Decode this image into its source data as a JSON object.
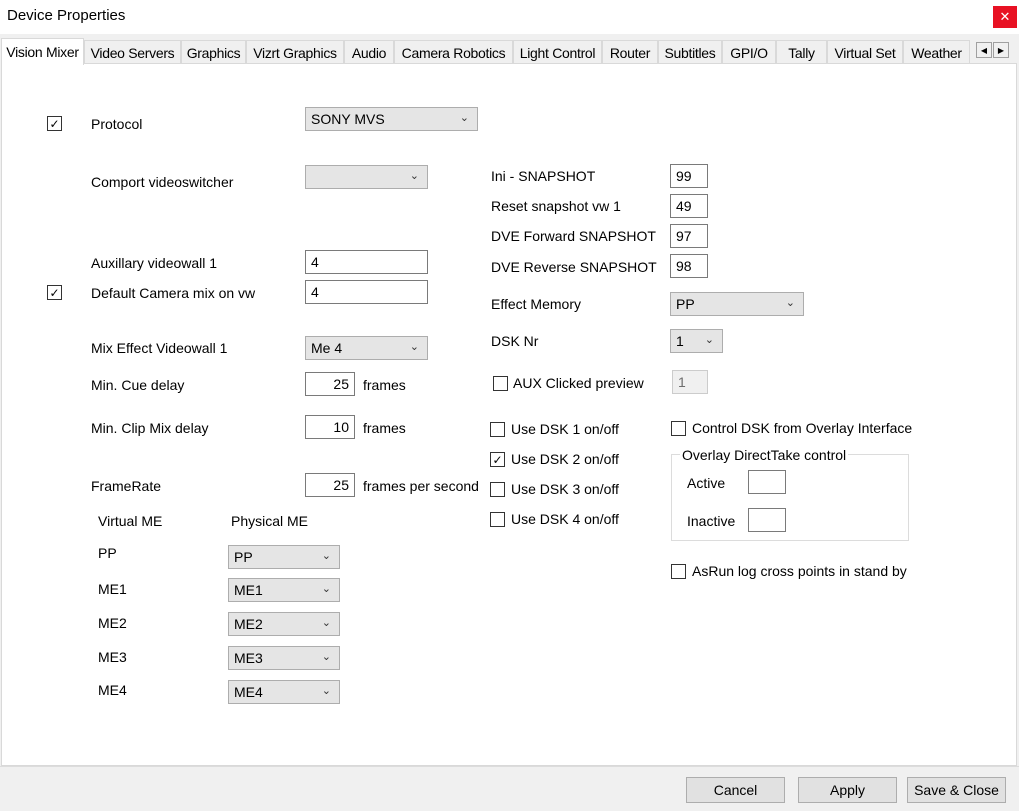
{
  "window": {
    "title": "Device Properties",
    "close_glyph": "✕"
  },
  "tabs": [
    "Vision Mixer",
    "Video Servers",
    "Graphics",
    "Vizrt Graphics",
    "Audio",
    "Camera Robotics",
    "Light Control",
    "Router",
    "Subtitles",
    "GPI/O",
    "Tally",
    "Virtual Set",
    "Weather"
  ],
  "tab_scroll": {
    "left": "◀",
    "right": "▶"
  },
  "left": {
    "protocol": {
      "label": "Protocol",
      "checked": "✓",
      "value": "SONY MVS"
    },
    "comport": {
      "label": "Comport videoswitcher",
      "value": ""
    },
    "aux_videowall": {
      "label": "Auxillary videowall 1",
      "value": "4"
    },
    "default_camera_mix": {
      "label": "Default Camera mix on vw",
      "checked": "✓",
      "value": "4"
    },
    "mix_effect_videowall": {
      "label": "Mix Effect Videowall 1",
      "value": "Me 4"
    },
    "min_cue_delay": {
      "label": "Min. Cue delay",
      "value": "25",
      "unit": "frames"
    },
    "min_clip_mix_delay": {
      "label": "Min. Clip Mix delay",
      "value": "10",
      "unit": "frames"
    },
    "framerate": {
      "label": "FrameRate",
      "value": "25",
      "unit": "frames per second"
    },
    "me_mapping": {
      "header_virtual": "Virtual ME",
      "header_physical": "Physical ME",
      "rows": [
        {
          "virtual": "PP",
          "physical": "PP"
        },
        {
          "virtual": "ME1",
          "physical": "ME1"
        },
        {
          "virtual": "ME2",
          "physical": "ME2"
        },
        {
          "virtual": "ME3",
          "physical": "ME3"
        },
        {
          "virtual": "ME4",
          "physical": "ME4"
        }
      ]
    }
  },
  "middle": {
    "ini_snapshot": {
      "label": "Ini - SNAPSHOT",
      "value": "99"
    },
    "reset_snapshot": {
      "label": "Reset snapshot vw 1",
      "value": "49"
    },
    "dve_forward": {
      "label": "DVE Forward SNAPSHOT",
      "value": "97"
    },
    "dve_reverse": {
      "label": "DVE Reverse SNAPSHOT",
      "value": "98"
    },
    "effect_memory": {
      "label": "Effect Memory",
      "value": "PP"
    },
    "dsk_nr": {
      "label": "DSK Nr",
      "value": "1"
    },
    "aux_clicked_preview": {
      "label": "AUX Clicked preview",
      "checked": "",
      "value": "1"
    },
    "use_dsk": [
      {
        "label": "Use DSK 1 on/off",
        "checked": ""
      },
      {
        "label": "Use DSK 2 on/off",
        "checked": "✓"
      },
      {
        "label": "Use DSK 3 on/off",
        "checked": ""
      },
      {
        "label": "Use DSK 4 on/off",
        "checked": ""
      }
    ]
  },
  "right": {
    "control_dsk_overlay": {
      "label": "Control DSK from Overlay Interface",
      "checked": ""
    },
    "overlay_group": {
      "title": "Overlay DirectTake control",
      "active_label": "Active",
      "active_value": "",
      "inactive_label": "Inactive",
      "inactive_value": ""
    },
    "asrun_log": {
      "label": "AsRun log cross points in stand by",
      "checked": ""
    }
  },
  "footer": {
    "cancel": "Cancel",
    "apply": "Apply",
    "save_close": "Save & Close"
  },
  "colors": {
    "close": "#e81123",
    "panel": "#ffffff",
    "chrome": "#f0f0f0"
  }
}
